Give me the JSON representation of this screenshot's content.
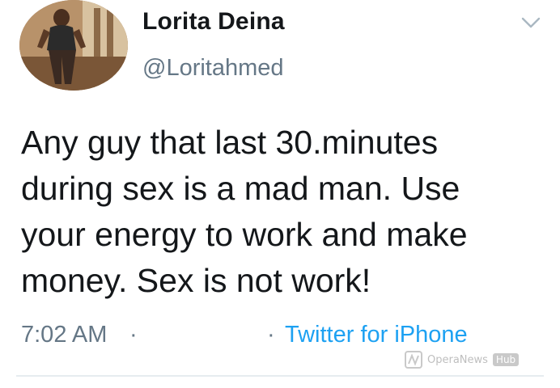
{
  "tweet": {
    "display_name": "Lorita Deina",
    "handle": "@Loritahmed",
    "text": "Any guy that last 30.minutes\nduring sex is a mad man. Use\nyour energy to work and make\nmoney. Sex is not work!",
    "time": "7:02 AM",
    "separator": "·",
    "source": "Twitter for iPhone",
    "link_color": "#1da1f2",
    "muted_color": "#657786"
  },
  "icons": {
    "menu": "chevron-down-icon",
    "avatar": "avatar-photo"
  },
  "watermark": {
    "text": "OperaNews",
    "badge": "Hub"
  }
}
